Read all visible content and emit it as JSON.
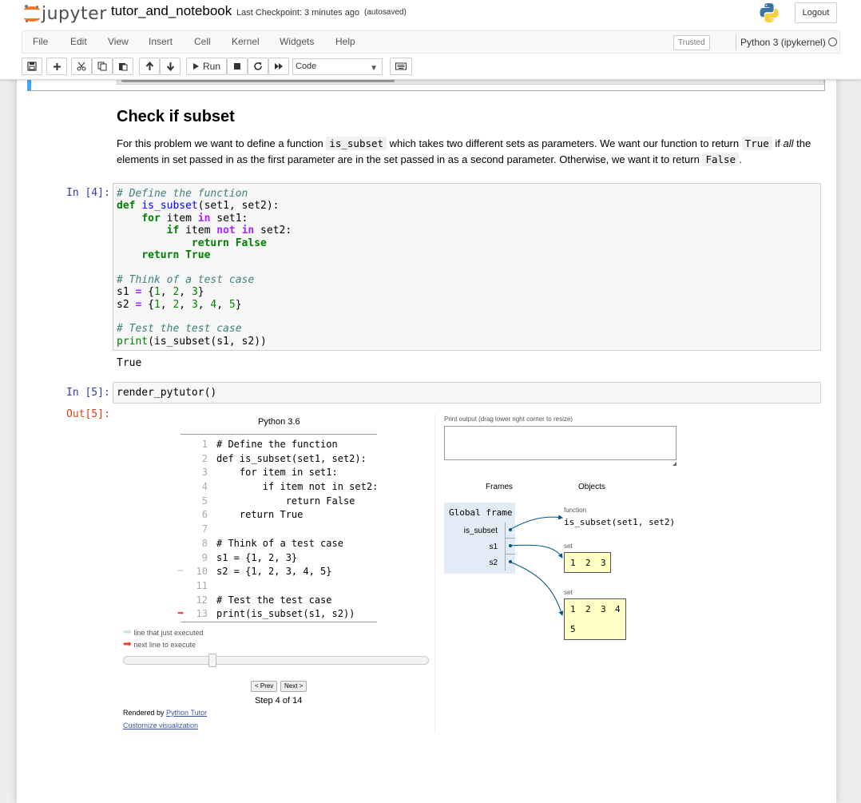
{
  "header": {
    "logo_text": "jupyter",
    "notebook_name": "tutor_and_notebook",
    "checkpoint": "Last Checkpoint: 3 minutes ago",
    "autosave": "(autosaved)",
    "logout_label": "Logout"
  },
  "menu": {
    "items": [
      "File",
      "Edit",
      "View",
      "Insert",
      "Cell",
      "Kernel",
      "Widgets",
      "Help"
    ],
    "trusted": "Trusted",
    "kernel": "Python 3 (ipykernel)"
  },
  "toolbar": {
    "run_label": "Run",
    "cell_type": "Code",
    "icons": [
      "save-icon",
      "plus-icon",
      "cut-icon",
      "copy-icon",
      "paste-icon",
      "arrow-up-icon",
      "arrow-down-icon",
      "run-icon",
      "stop-icon",
      "restart-icon",
      "fast-forward-icon",
      "keyboard-icon"
    ]
  },
  "markdown": {
    "heading": "Check if subset",
    "para_1": "For this problem we want to define a function ",
    "code_1": "is_subset",
    "para_2": " which takes two different sets as parameters. We want our function to return ",
    "code_2": "True",
    "para_3": " if ",
    "em": "all",
    "para_4": " the elements in set passed in as the first parameter are in the set passed in as a second parameter. Otherwise, we want it to return ",
    "code_3": "False",
    "para_5": "."
  },
  "cell4": {
    "prompt": "In [4]:",
    "output": "True"
  },
  "cell5": {
    "prompt": "In [5]:",
    "code": "render_pytutor()",
    "out_prompt": "Out[5]:"
  },
  "tutor": {
    "language": "Python 3.6",
    "code_lines": [
      {
        "n": "1",
        "text": "# Define the function"
      },
      {
        "n": "2",
        "text": "def is_subset(set1, set2):"
      },
      {
        "n": "3",
        "text": "    for item in set1:"
      },
      {
        "n": "4",
        "text": "        if item not in set2:"
      },
      {
        "n": "5",
        "text": "            return False"
      },
      {
        "n": "6",
        "text": "    return True"
      },
      {
        "n": "7",
        "text": ""
      },
      {
        "n": "8",
        "text": "# Think of a test case"
      },
      {
        "n": "9",
        "text": "s1 = {1, 2, 3}"
      },
      {
        "n": "10",
        "text": "s2 = {1, 2, 3, 4, 5}"
      },
      {
        "n": "11",
        "text": ""
      },
      {
        "n": "12",
        "text": "# Test the test case"
      },
      {
        "n": "13",
        "text": "print(is_subset(s1, s2))"
      }
    ],
    "just_executed_line": 10,
    "next_line": 13,
    "legend_just_executed": "line that just executed",
    "legend_next": "next line to execute",
    "prev_label": "< Prev",
    "next_label": "Next >",
    "step_text": "Step 4 of 14",
    "step_fraction": 0.2857,
    "rendered_by": "Rendered by ",
    "rendered_link": "Python Tutor",
    "customize": "Customize visualization",
    "print_label": "Print output (drag lower right corner to resize)",
    "frames_label": "Frames",
    "objects_label": "Objects",
    "frame_title": "Global frame",
    "vars": [
      "is_subset",
      "s1",
      "s2"
    ],
    "function_type": "function",
    "function_sig": "is_subset(set1, set2)",
    "set_type": "set",
    "set1_values": [
      "1",
      "2",
      "3"
    ],
    "set2_values": [
      "1",
      "2",
      "3",
      "4",
      "5"
    ],
    "colors": {
      "just_executed": "#c9e6ca",
      "next": "#e93f34",
      "frame_bg": "#e2ebf6",
      "object_bg": "#ffffc6",
      "arrow": "#005583"
    }
  }
}
